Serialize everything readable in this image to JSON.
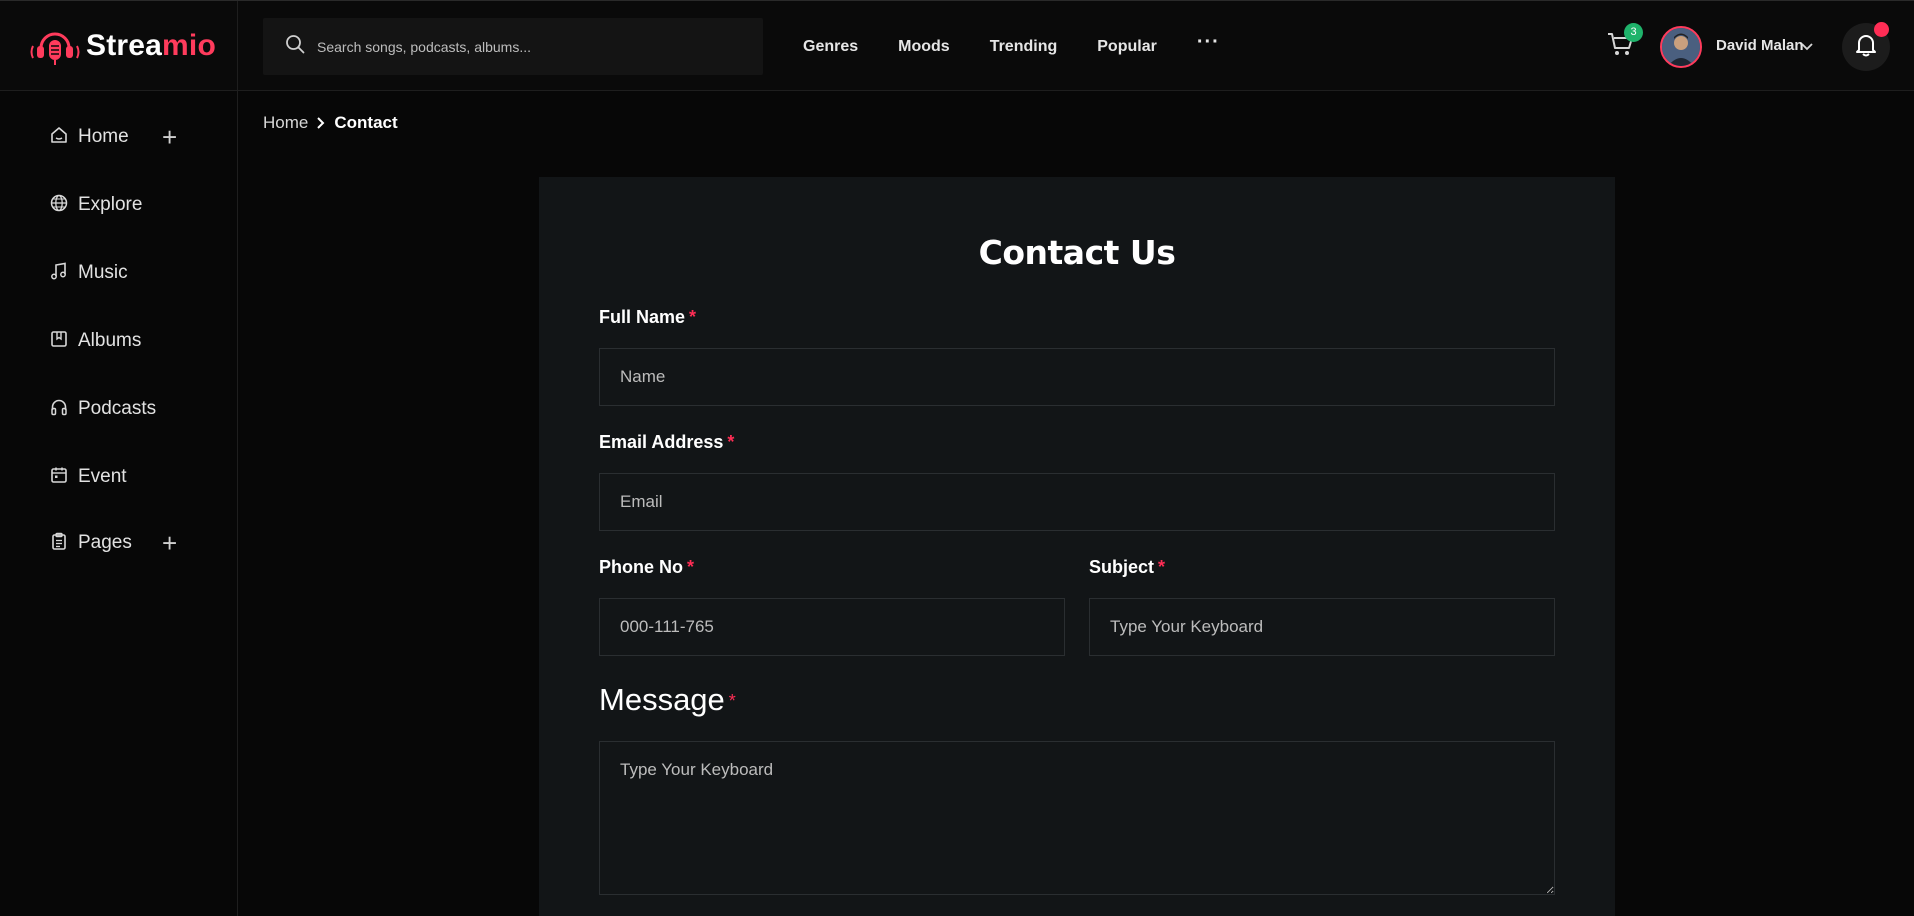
{
  "brand": {
    "name_part1": "Strea",
    "name_part2": "mio",
    "accent_color": "#ff3b5c"
  },
  "search": {
    "placeholder": "Search songs, podcasts, albums..."
  },
  "topnav": {
    "items": [
      "Genres",
      "Moods",
      "Trending",
      "Popular"
    ],
    "more": "···"
  },
  "cart": {
    "count": "3",
    "icon": "cart-icon"
  },
  "user": {
    "name": "David Malan"
  },
  "notifications": {
    "icon": "bell-icon",
    "has_unread": true
  },
  "sidebar": {
    "items": [
      {
        "label": "Home",
        "icon": "home-icon",
        "expandable": true
      },
      {
        "label": "Explore",
        "icon": "globe-icon"
      },
      {
        "label": "Music",
        "icon": "music-note-icon"
      },
      {
        "label": "Albums",
        "icon": "album-icon"
      },
      {
        "label": "Podcasts",
        "icon": "headphones-icon"
      },
      {
        "label": "Event",
        "icon": "calendar-icon"
      },
      {
        "label": "Pages",
        "icon": "clipboard-icon",
        "expandable": true
      }
    ],
    "plus": "+"
  },
  "breadcrumb": {
    "home": "Home",
    "current": "Contact"
  },
  "form": {
    "title": "Contact Us",
    "required_mark": "*",
    "full_name": {
      "label": "Full Name",
      "placeholder": "Name"
    },
    "email": {
      "label": "Email Address",
      "placeholder": "Email"
    },
    "phone": {
      "label": "Phone No",
      "placeholder": "000-111-765"
    },
    "subject": {
      "label": "Subject",
      "placeholder": "Type Your Keyboard"
    },
    "message": {
      "label": "Message",
      "placeholder": "Type Your Keyboard"
    }
  }
}
